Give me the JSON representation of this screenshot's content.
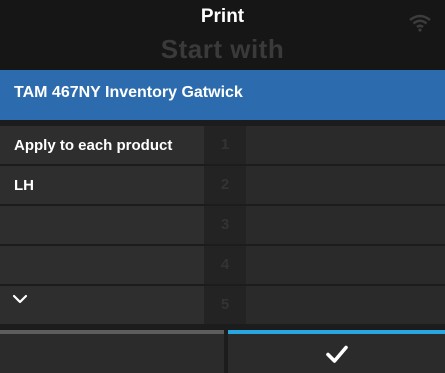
{
  "header": {
    "title": "Print",
    "ghost_text": "Start with",
    "wifi_icon": "wifi-icon"
  },
  "selected": {
    "label": "TAM 467NY Inventory Gatwick"
  },
  "list": {
    "rows": [
      {
        "label": "Apply to each product",
        "num": "1"
      },
      {
        "label": "LH",
        "num": "2"
      },
      {
        "label": "",
        "num": "3"
      },
      {
        "label": "",
        "num": "4"
      },
      {
        "label": "",
        "num": "5"
      }
    ],
    "scroll_icon": "chevron-down-icon"
  },
  "footer": {
    "confirm_icon": "checkmark-icon",
    "colors": {
      "confirm_accent": "#29a6e0",
      "cancel_accent": "#5d5d5d"
    }
  },
  "colors": {
    "selected_bar": "#2c6cae"
  }
}
